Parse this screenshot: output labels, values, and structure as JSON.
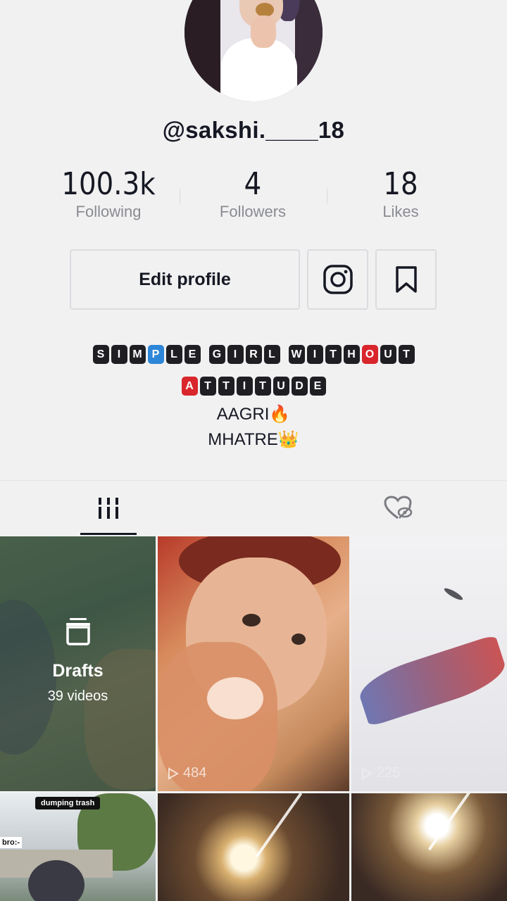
{
  "profile": {
    "username": "@sakshi.____18"
  },
  "stats": {
    "following": {
      "value": "100.3k",
      "label": "Following"
    },
    "followers": {
      "value": "4",
      "label": "Followers"
    },
    "likes": {
      "value": "18",
      "label": "Likes"
    }
  },
  "actions": {
    "edit_profile": "Edit profile",
    "instagram_icon": "instagram-icon",
    "bookmark_icon": "bookmark-icon"
  },
  "bio": {
    "line1_words": [
      "SIMPLE",
      "GIRL",
      "WITHOUT"
    ],
    "line2_words": [
      "ATTITUDE"
    ],
    "line3": "AAGRI🔥",
    "line4": "MHATRE👑",
    "highlight_colors": {
      "blue": "#2e86d8",
      "red": "#d9262c"
    }
  },
  "tabs": {
    "videos_icon": "grid-icon",
    "liked_icon": "liked-hidden-icon"
  },
  "grid": {
    "drafts": {
      "title": "Drafts",
      "count": "39 videos"
    },
    "items": [
      {
        "views": "484"
      },
      {
        "views": "225"
      }
    ],
    "captions": {
      "top": "dumping trash",
      "side": "bro:-"
    }
  }
}
